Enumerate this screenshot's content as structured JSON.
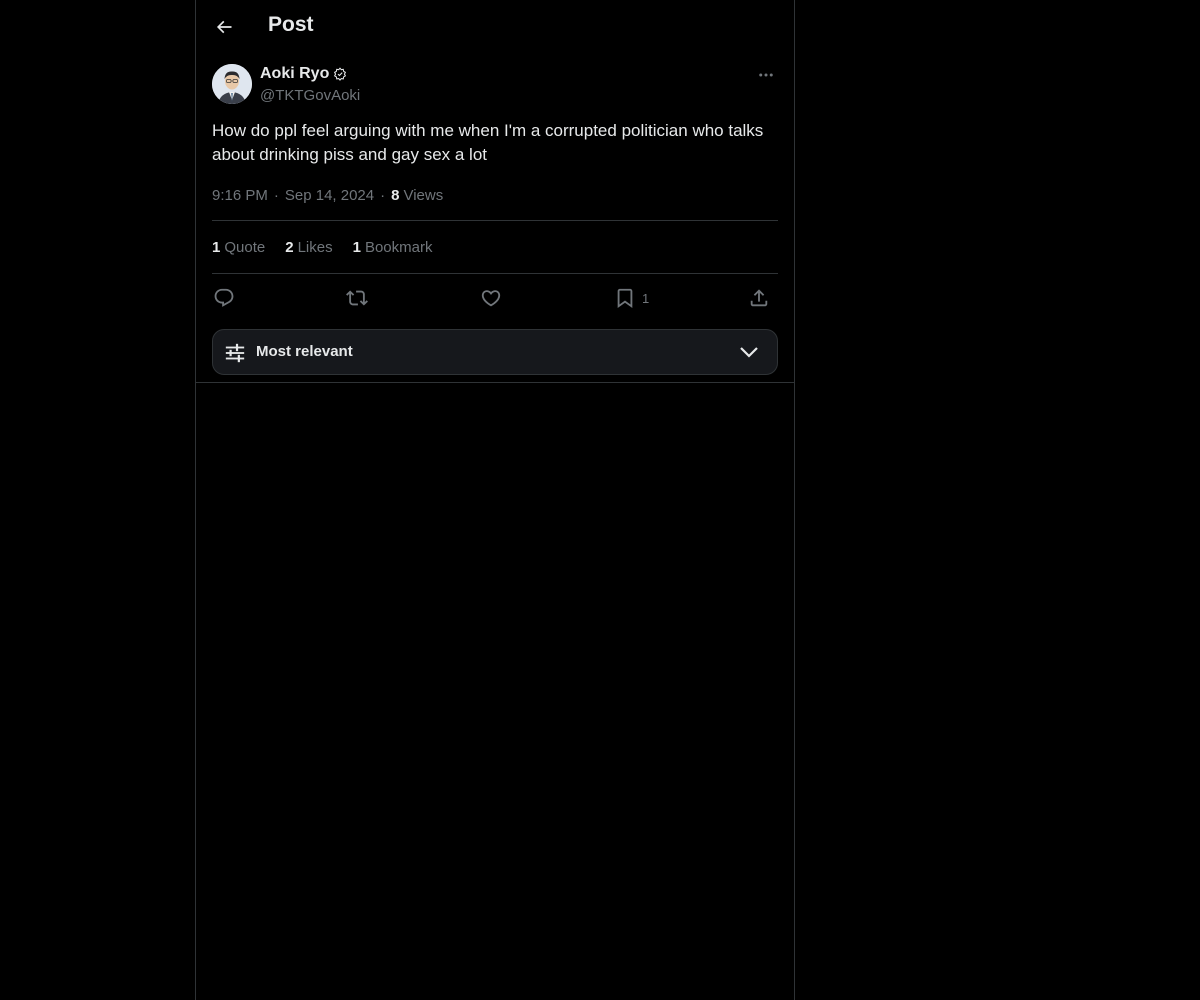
{
  "header": {
    "title": "Post",
    "back_icon": "arrow-left-icon"
  },
  "author": {
    "name": "Aoki Ryo",
    "handle": "@TKTGovAoki",
    "badge_icon": "verified-badge-icon"
  },
  "post": {
    "text": "How do ppl feel arguing with me when I'm a corrupted politician who talks about drinking piss and gay sex a lot",
    "time": "9:16 PM",
    "date": "Sep 14, 2024",
    "views_count": "8",
    "views_label": "Views"
  },
  "stats": {
    "quotes_count": "1",
    "quotes_label": "Quote",
    "likes_count": "2",
    "likes_label": "Likes",
    "bookmarks_count": "1",
    "bookmarks_label": "Bookmark"
  },
  "actions": {
    "bookmark_count": "1",
    "icons": [
      "reply-icon",
      "repost-icon",
      "like-icon",
      "bookmark-icon",
      "share-icon"
    ]
  },
  "sort": {
    "label": "Most relevant"
  },
  "colors": {
    "background": "#000000",
    "text_primary": "#e7e9ea",
    "text_secondary": "#71767b",
    "border": "#2f3336",
    "sort_bg": "#16181c"
  }
}
